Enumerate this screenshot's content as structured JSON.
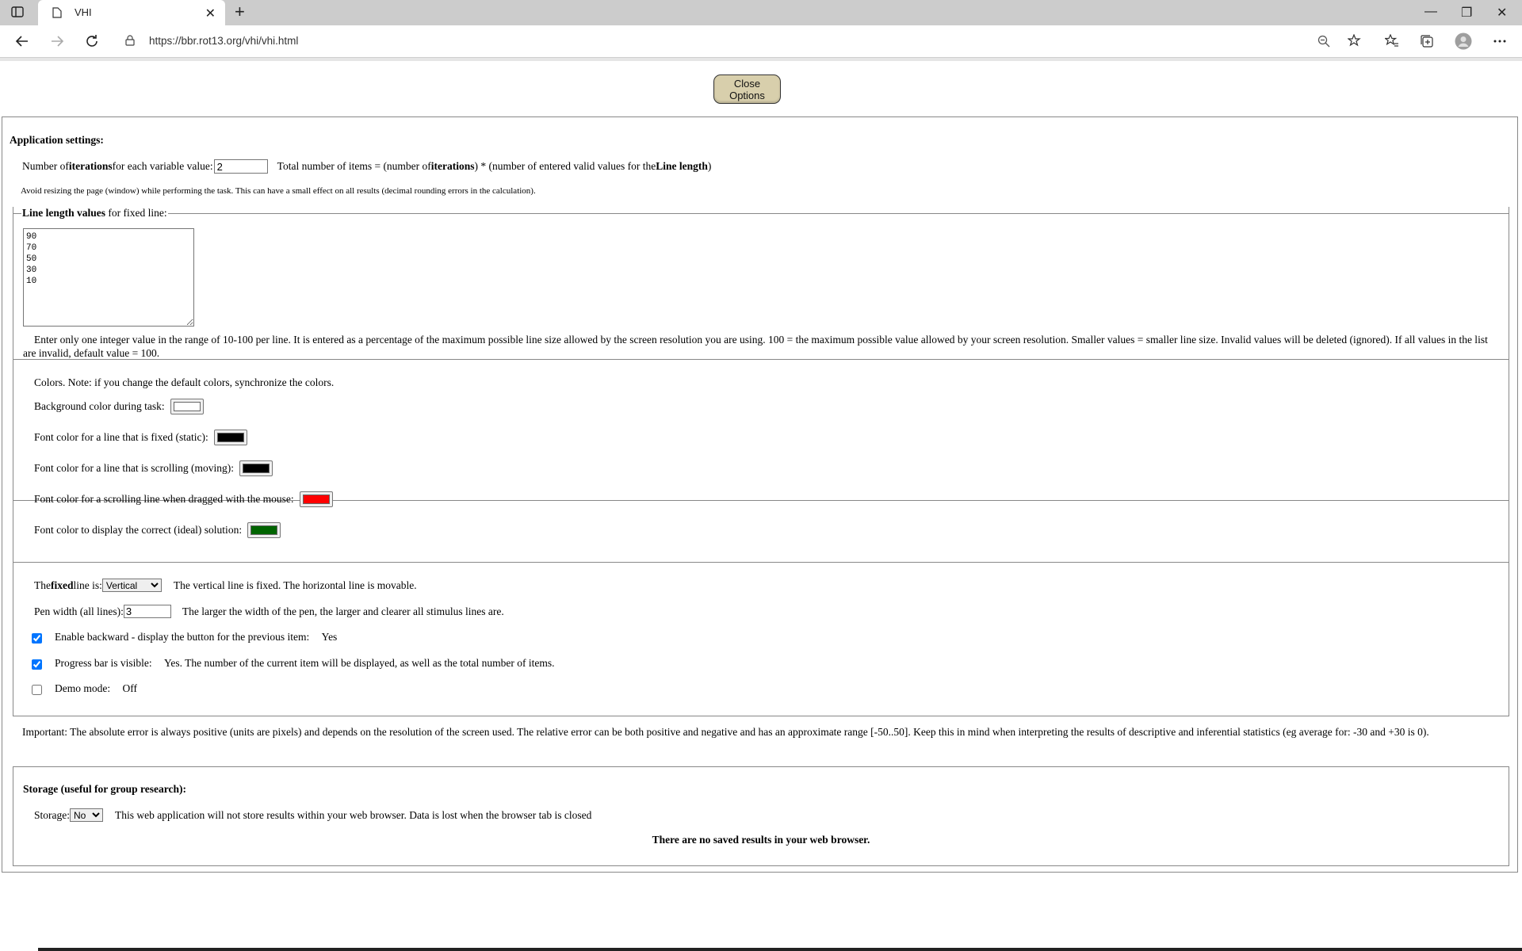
{
  "browser": {
    "tab_title": "VHI",
    "url": "https://bbr.rot13.org/vhi/vhi.html",
    "icons": [
      "sidebar-icon",
      "page-icon",
      "close-icon",
      "plus-icon",
      "minimize-icon",
      "restore-icon",
      "window-close-icon",
      "back-icon",
      "forward-icon",
      "refresh-icon",
      "lock-icon",
      "zoom-icon",
      "favorite-add-icon",
      "favorites-icon",
      "collections-icon",
      "profile-icon",
      "more-icon"
    ]
  },
  "options": {
    "close_button": "Close Options"
  },
  "app_settings": {
    "heading": "Application settings:",
    "iterations_pre": "Number of ",
    "iterations_bold": "iterations",
    "iterations_post": " for each variable value:",
    "iterations_value": "2",
    "total_pre": "Total number of items = (number of ",
    "total_bold1": "iterations",
    "total_mid": ") * (number of entered valid values for the ",
    "total_bold2": "Line length",
    "total_post": ")",
    "avoid_note": "Avoid resizing the page (window) while performing the task. This can have a small effect on all results (decimal rounding errors in the calculation)."
  },
  "line_length": {
    "legend_bold": "Line length values",
    "legend_rest": " for fixed line:",
    "values": "90\n70\n50\n30\n10",
    "note": "Enter only one integer value in the range of 10-100 per line. It is entered as a percentage of the maximum possible line size allowed by the screen resolution you are using. 100 = the maximum possible value allowed by your screen resolution. Smaller values = smaller line size. Invalid values will be deleted (ignored). If all values in the list are invalid, default value = 100."
  },
  "colors": {
    "note": "Colors. Note: if you change the default colors, synchronize the colors.",
    "background_label": "Background color during task:",
    "background_color": "#ffffff",
    "fixed_label": "Font color for a line that is fixed (static):",
    "fixed_color": "#000000",
    "scrolling_label": "Font color for a line that is scrolling (moving):",
    "scrolling_color": "#000000",
    "dragged_label": "Font color for a scrolling line when dragged with the mouse:",
    "dragged_color": "#ff0000",
    "solution_label": "Font color to display the correct (ideal) solution:",
    "solution_color": "#006400"
  },
  "settings": {
    "fixed_pre": "The ",
    "fixed_bold": "fixed",
    "fixed_post": " line is:",
    "fixed_value": "Vertical",
    "fixed_note": "The vertical line is fixed. The horizontal line is movable.",
    "pen_label": "Pen width (all lines):",
    "pen_value": "3",
    "pen_note": "The larger the width of the pen, the larger and clearer all stimulus lines are.",
    "backward_label": "Enable backward - display the button for the previous item:",
    "backward_value": "Yes",
    "backward_checked": true,
    "progress_label": "Progress bar is visible:",
    "progress_value": "Yes. The number of the current item will be displayed, as well as the total number of items.",
    "progress_checked": true,
    "demo_label": "Demo mode:",
    "demo_value": "Off",
    "demo_checked": false
  },
  "important": "Important: The absolute error is always positive (units are pixels) and depends on the resolution of the screen used. The relative error can be both positive and negative and has an approximate range [-50..50]. Keep this in mind when interpreting the results of descriptive and inferential statistics (eg average for: -30 and +30 is 0).",
  "storage": {
    "heading": "Storage (useful for group research):",
    "label": "Storage:",
    "value": "No",
    "note": "This web application will not store results within your web browser. Data is lost when the browser tab is closed",
    "saved": "There are no saved results in your web browser."
  }
}
